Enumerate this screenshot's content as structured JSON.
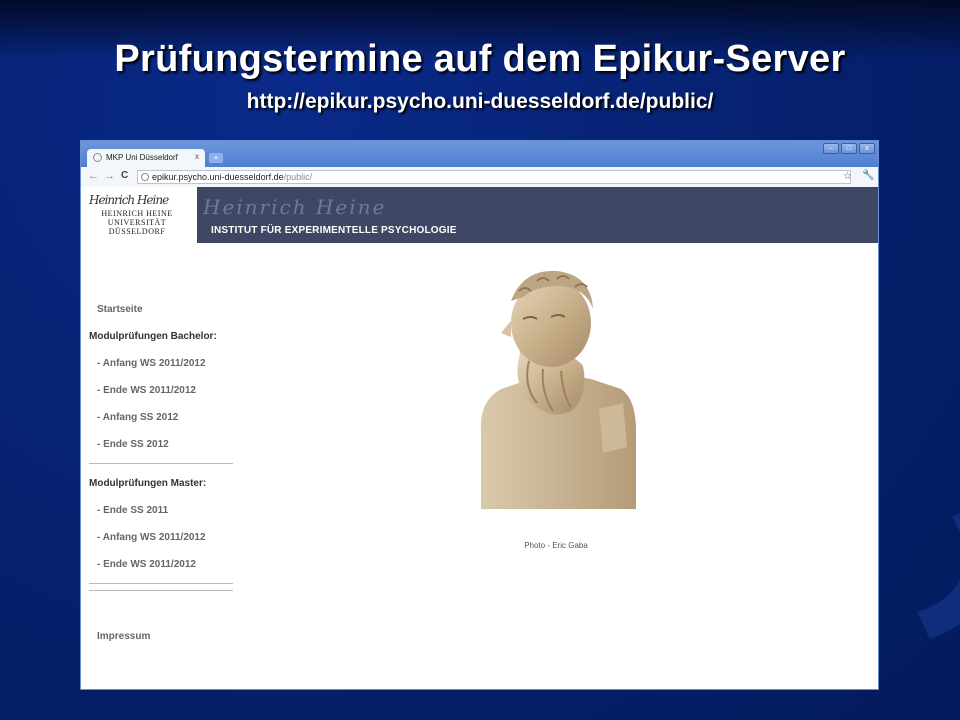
{
  "slide": {
    "title": "Prüfungstermine auf dem Epikur-Server",
    "subtitle": "http://epikur.psycho.uni-duesseldorf.de/public/"
  },
  "browser": {
    "tab_title": "MKP Uni Düsseldorf",
    "new_tab_glyph": "+",
    "tab_close_glyph": "x",
    "window_buttons": [
      "–",
      "□",
      "x"
    ],
    "url_host": "epikur.psycho.uni-duesseldorf.de",
    "url_path": "/public/",
    "nav_glyphs": {
      "back": "←",
      "forward": "→",
      "reload": "C"
    },
    "icons": [
      "back-icon",
      "forward-icon",
      "reload-icon",
      "page-icon",
      "star-icon",
      "wrench-icon"
    ]
  },
  "site": {
    "logo": {
      "signature": "Heinrich Heine",
      "lines": [
        "HEINRICH HEINE",
        "UNIVERSITÄT",
        "DÜSSELDORF"
      ]
    },
    "banner_signature": "Heinrich Heine",
    "banner_title": "INSTITUT FÜR EXPERIMENTELLE PSYCHOLOGIE",
    "nav": {
      "startseite": "Startseite",
      "bachelor_heading": "Modulprüfungen Bachelor:",
      "bachelor_links": [
        "- Anfang WS 2011/2012",
        "- Ende WS 2011/2012",
        "- Anfang SS 2012",
        "- Ende SS 2012"
      ],
      "master_heading": "Modulprüfungen Master:",
      "master_links": [
        "- Ende SS 2011",
        "- Anfang WS 2011/2012",
        "- Ende WS 2011/2012"
      ],
      "impressum": "Impressum"
    },
    "photo_caption": "Photo - Eric Gaba"
  },
  "colors": {
    "slide_background": "#062272",
    "banner": "#3e4864",
    "browser_frame": "#5a88d6"
  }
}
